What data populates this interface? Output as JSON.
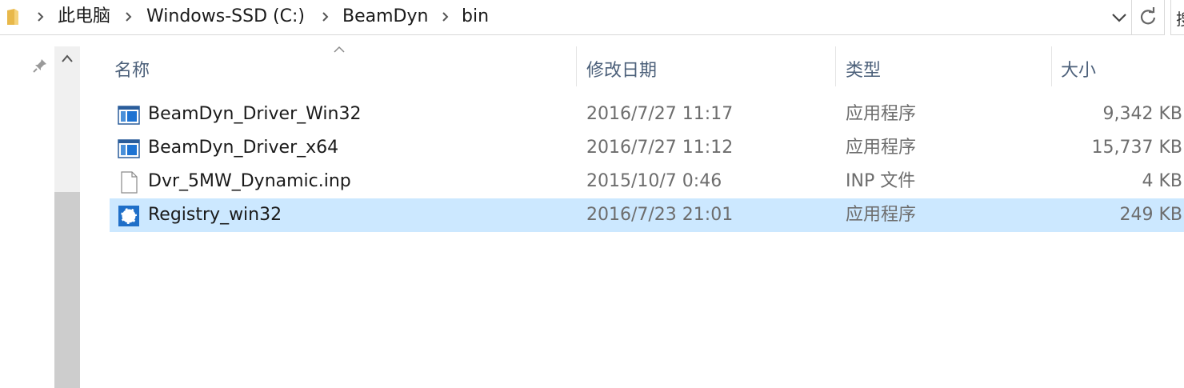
{
  "address": {
    "crumbs": [
      "此电脑",
      "Windows-SSD (C:)",
      "BeamDyn",
      "bin"
    ],
    "search_partial": "搜"
  },
  "columns": {
    "name": "名称",
    "date": "修改日期",
    "type": "类型",
    "size": "大小"
  },
  "files": [
    {
      "name": "BeamDyn_Driver_Win32",
      "date": "2016/7/27 11:17",
      "type": "应用程序",
      "size": "9,342 KB",
      "icon": "application-icon"
    },
    {
      "name": "BeamDyn_Driver_x64",
      "date": "2016/7/27 11:12",
      "type": "应用程序",
      "size": "15,737 KB",
      "icon": "application-icon"
    },
    {
      "name": "Dvr_5MW_Dynamic.inp",
      "date": "2015/10/7 0:46",
      "type": "INP 文件",
      "size": "4 KB",
      "icon": "document-icon"
    },
    {
      "name": "Registry_win32",
      "date": "2016/7/23 21:01",
      "type": "应用程序",
      "size": "249 KB",
      "icon": "registry-app-icon",
      "selected": true
    }
  ],
  "colors": {
    "selection": "#cce8ff",
    "header_text": "#4c607a",
    "folder": "#e8b84a"
  }
}
